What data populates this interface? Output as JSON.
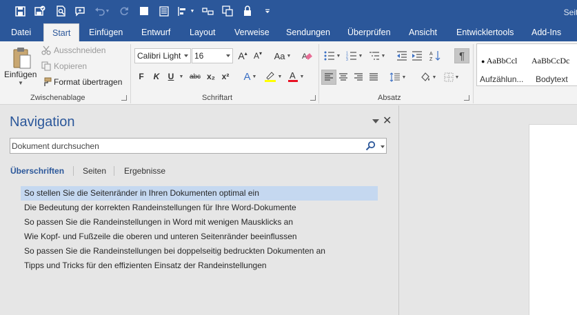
{
  "title_bar": {
    "title_partial": "Seite",
    "quick_access": [
      "save-icon",
      "save-as-icon",
      "print-preview-icon",
      "comment-icon",
      "undo-icon",
      "redo-icon",
      "new-doc-icon",
      "form-icon",
      "align-icon",
      "layout-icon",
      "share-icon",
      "lock-icon",
      "customize-icon"
    ]
  },
  "tabs": [
    "Datei",
    "Start",
    "Einfügen",
    "Entwurf",
    "Layout",
    "Verweise",
    "Sendungen",
    "Überprüfen",
    "Ansicht",
    "Entwicklertools",
    "Add-Ins"
  ],
  "active_tab": "Start",
  "ribbon": {
    "clipboard": {
      "paste_label": "Einfügen",
      "cut_label": "Ausschneiden",
      "copy_label": "Kopieren",
      "format_painter_label": "Format übertragen",
      "group_label": "Zwischenablage"
    },
    "font": {
      "font_name": "Calibri Light",
      "font_size": "16",
      "grow_glyph": "A",
      "shrink_glyph": "A",
      "case_glyph": "Aa",
      "bold": "F",
      "italic": "K",
      "underline": "U",
      "strikethrough": "abc",
      "subscript": "x₂",
      "superscript": "x²",
      "effects_glyph": "A",
      "color_glyph": "A",
      "group_label": "Schriftart"
    },
    "paragraph": {
      "group_label": "Absatz"
    },
    "styles": {
      "items": [
        {
          "sample": "AaBbCcl",
          "name": "Aufzählun..."
        },
        {
          "sample": "AaBbCcDc",
          "name": "Bodytext"
        }
      ]
    },
    "colors": {
      "ribbon_bg": "#f3f3f3",
      "brand": "#2b579a",
      "highlight": "#ffff00",
      "font_color": "#e81123"
    }
  },
  "navigation": {
    "title": "Navigation",
    "search_placeholder": "Dokument durchsuchen",
    "tabs": [
      "Überschriften",
      "Seiten",
      "Ergebnisse"
    ],
    "active_tab": "Überschriften",
    "headings": [
      "So stellen Sie die Seitenränder in Ihren Dokumenten optimal ein",
      "Die Bedeutung der korrekten Randeinstellungen für Ihre Word-Dokumente",
      "So passen Sie die Randeinstellungen in Word mit wenigen Mausklicks an",
      "Wie Kopf- und Fußzeile die oberen und unteren Seitenränder beeinflussen",
      "So passen Sie die Randeinstellungen bei doppelseitig bedruckten Dokumenten an",
      "Tipps und Tricks für den effizienten Einsatz der Randeinstellungen"
    ],
    "selected_heading_index": 0
  }
}
